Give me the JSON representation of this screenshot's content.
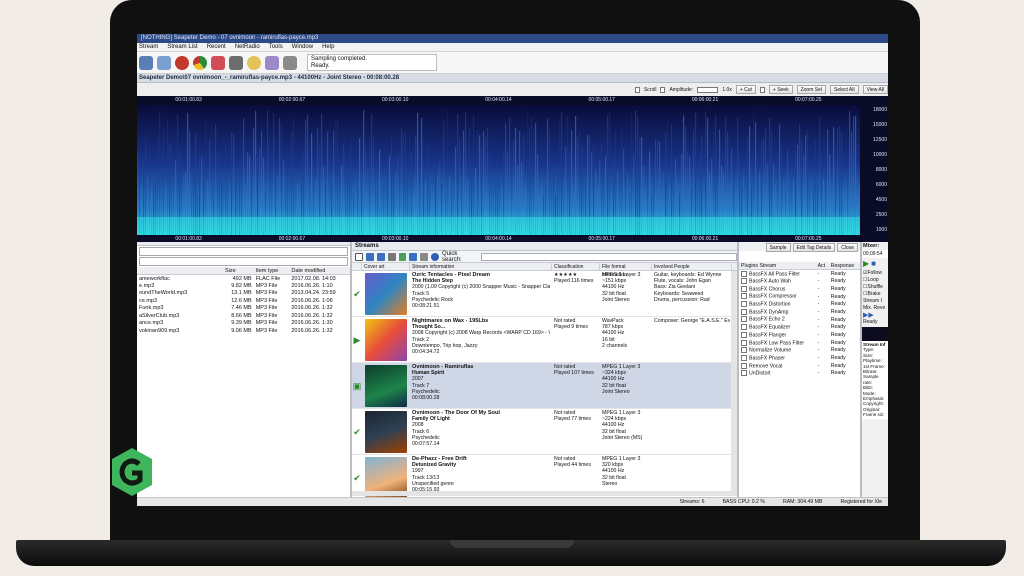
{
  "window": {
    "title": "[NOTHING] Seapeter Demo - 07 ovnimoon - ramiruflas-payce.mp3"
  },
  "menu": [
    "Stream",
    "Stream List",
    "Recent",
    "NetRadio",
    "Tools",
    "Window",
    "Help"
  ],
  "toolbar": {
    "status_line1": "Sampling completed.",
    "status_line2": "Ready."
  },
  "file_bar": "Seapeter Demo\\07 ovnimoon_-_ramiruflas-payce.mp3 - 44100Hz - Joint Stereo - 00:08:00.28",
  "spectrum_controls": {
    "scroll": "Scroll",
    "amplitude": "Amplitude:",
    "zoom_value": "1.0x",
    "cut": "Cut",
    "seek": "Seek",
    "zoom_sel": "Zoom Sel",
    "select_all": "Select All",
    "view_all": "View All"
  },
  "time_ticks": [
    "00:01:00.83",
    "00:02:00.67",
    "00:03:00.10",
    "00:04:00.14",
    "00:05:00.17",
    "00:06:00.21",
    "00:07:00.25"
  ],
  "freq_ticks": [
    "18000",
    "15000",
    "12500",
    "10000",
    "8000",
    "6000",
    "4500",
    "2500",
    "1000"
  ],
  "file_pane": {
    "columns": [
      "",
      "Size",
      "Item type",
      "Date modified"
    ],
    "files": [
      {
        "name": "ameworkflac",
        "size": "492 MB",
        "type": "FLAC File",
        "date": "2017.02.08. 14:03"
      },
      {
        "name": "e.mp3",
        "size": "9.82 MB",
        "type": "MP3 File",
        "date": "2016.06.26. 1:10"
      },
      {
        "name": "oundTheWorld.mp3",
        "size": "13.1 MB",
        "type": "MP3 File",
        "date": "2013.04.24. 23:59"
      },
      {
        "name": "ce.mp3",
        "size": "12.6 MB",
        "type": "MP3 File",
        "date": "2016.06.26. 1:06"
      },
      {
        "name": "Funk.mp3",
        "size": "7.46 MB",
        "type": "MP3 File",
        "date": "2016.06.26. 1:32"
      },
      {
        "name": "aSilverClub.mp3",
        "size": "8.66 MB",
        "type": "MP3 File",
        "date": "2016.06.26. 1:32"
      },
      {
        "name": "ance.mp3",
        "size": "9.39 MB",
        "type": "MP3 File",
        "date": "2016.06.26. 1:30"
      },
      {
        "name": "vokinan909.mp3",
        "size": "9.06 MB",
        "type": "MP3 File",
        "date": "2016.06.26. 1:32"
      }
    ]
  },
  "streams": {
    "title": "Streams",
    "quick_search_label": "Quick search:",
    "sample_btn": "Sample",
    "edit_tags_btn": "Edit Tag Details",
    "close_btn": "Close",
    "columns": [
      "Cover art",
      "Stream information",
      "Classification",
      "File format information",
      "Involved People"
    ],
    "rows": [
      {
        "title": "Ozric Tentacles - Pixel Dream",
        "album": "The Hidden Step",
        "line3": "2000 (1.09 Copyright (c) 2000 Snapper Music - Snapper Classics",
        "track": "Track 5",
        "genre": "Psychedelic Rock",
        "dur": "00:08:21.51",
        "rating": "★★★★★",
        "played": "Played 116 times",
        "fmt": [
          "MPEG 1 Layer 3",
          "~151 kbps",
          "44100 Hz",
          "32 bit float",
          "Joint Stereo"
        ],
        "people": [
          "Guitar, keyboards: Ed Wynne",
          "Flute, vocals: John Egan",
          "Bass: Zia Geelani",
          "Keyboards: Seaweed",
          "Drums, percussion: Rad"
        ],
        "mark": "✔",
        "selected": false
      },
      {
        "title": "Nightmares on Wax - 195Lbs",
        "album": "Thought So...",
        "line3": "2008 Copyright (c) 2008 Warp Records <WARP CD 169> - W...",
        "track": "Track 2",
        "genre": "Downtempo, Trip hop, Jazzy",
        "dur": "00:04:34.72",
        "rating": "Not rated",
        "played": "Played 9 times",
        "fmt": [
          "WavPack",
          "787 kbps",
          "44100 Hz",
          "16 bit",
          "2 channels"
        ],
        "people": [
          "Composer: George \"E.A.S.E.\" Evel"
        ],
        "mark": "▶",
        "selected": false
      },
      {
        "title": "Ovnimoon - Ramiruflas",
        "album": "Human Spirit",
        "line3": "2007",
        "track": "Track 7",
        "genre": "Psychedelic",
        "dur": "00:08:00.28",
        "rating": "Not rated",
        "played": "Played 107 times",
        "fmt": [
          "MPEG 1 Layer 3",
          "~324 kbps",
          "44100 Hz",
          "32 bit float",
          "Joint Stereo"
        ],
        "people": [],
        "mark": "▣",
        "selected": true
      },
      {
        "title": "Ovnimoon - The Door Of My Soul",
        "album": "Family Of Light",
        "line3": "2008",
        "track": "Track 6",
        "genre": "Psychedelic",
        "dur": "00:07:57.14",
        "rating": "Not rated",
        "played": "Played 77 times",
        "fmt": [
          "MPEG 1 Layer 3",
          "~224 kbps",
          "44100 Hz",
          "32 bit float",
          "Joint Stereo (MS)"
        ],
        "people": [],
        "mark": "✔",
        "selected": false
      },
      {
        "title": "De-Phazz - Free Drift",
        "album": "Detunized Gravity",
        "line3": "1997",
        "track": "Track 13/13",
        "genre": "Unspecified genre",
        "dur": "00:05:15.93",
        "rating": "Not rated",
        "played": "Played 44 times",
        "fmt": [
          "MPEG 1 Layer 3",
          "320 kbps",
          "44100 Hz",
          "32 bit float",
          "Stereo"
        ],
        "people": [],
        "mark": "✔",
        "selected": false
      }
    ]
  },
  "plugins": {
    "columns": [
      "Plugins Stream",
      "Act",
      "Response"
    ],
    "items": [
      {
        "name": "BassFX All Pass Filter",
        "act": "-",
        "resp": "Ready"
      },
      {
        "name": "BassFX Auto Wah",
        "act": "-",
        "resp": "Ready"
      },
      {
        "name": "BassFX Chorus",
        "act": "-",
        "resp": "Ready"
      },
      {
        "name": "BassFX Compressor",
        "act": "-",
        "resp": "Ready"
      },
      {
        "name": "BassFX Distortion",
        "act": "-",
        "resp": "Ready"
      },
      {
        "name": "BassFX DynAmp",
        "act": "-",
        "resp": "Ready"
      },
      {
        "name": "BassFX Echo 2",
        "act": "-",
        "resp": "Ready"
      },
      {
        "name": "BassFX Equalizer",
        "act": "-",
        "resp": "Ready"
      },
      {
        "name": "BassFX Flanger",
        "act": "-",
        "resp": "Ready"
      },
      {
        "name": "BassFX Low Pass Filter",
        "act": "-",
        "resp": "Ready"
      },
      {
        "name": "Normalize Volume",
        "act": "-",
        "resp": "Ready"
      },
      {
        "name": "BassFX Phaser",
        "act": "-",
        "resp": "Ready"
      },
      {
        "name": "Remove Vocal",
        "act": "-",
        "resp": "Ready"
      },
      {
        "name": "UnDistort",
        "act": "-",
        "resp": "Ready"
      }
    ]
  },
  "mixer": {
    "title": "Mixer:",
    "time": "00:09:54",
    "checks": [
      "Follow",
      "Loop",
      "Shuffle",
      "Brake"
    ],
    "stream_label": "Stream I",
    "mix_label": "Mix. Reve",
    "ready": "Ready",
    "info": [
      "Stream Inf",
      "Type:",
      "Size:",
      "Playtime:",
      "1st Frame:",
      "Bitrate:",
      "Sample rate:",
      "BitD:",
      "Mode:",
      "Emphasis:",
      "Copyright:",
      "Original:",
      "Frame siz:"
    ]
  },
  "status_bar": {
    "streams": "Streams: 6",
    "cpu": "BASS CPU: 0.2 %",
    "ram": "RAM: 304.49 MB",
    "registered": "Registered for Xle"
  },
  "colors": {
    "titlebar": "#2d4a86",
    "spectrum_bg": "#0b0d3a",
    "spectrum_peak": "#33e0e6",
    "selection": "#cfd6e6",
    "logo_green": "#3fb65c"
  }
}
